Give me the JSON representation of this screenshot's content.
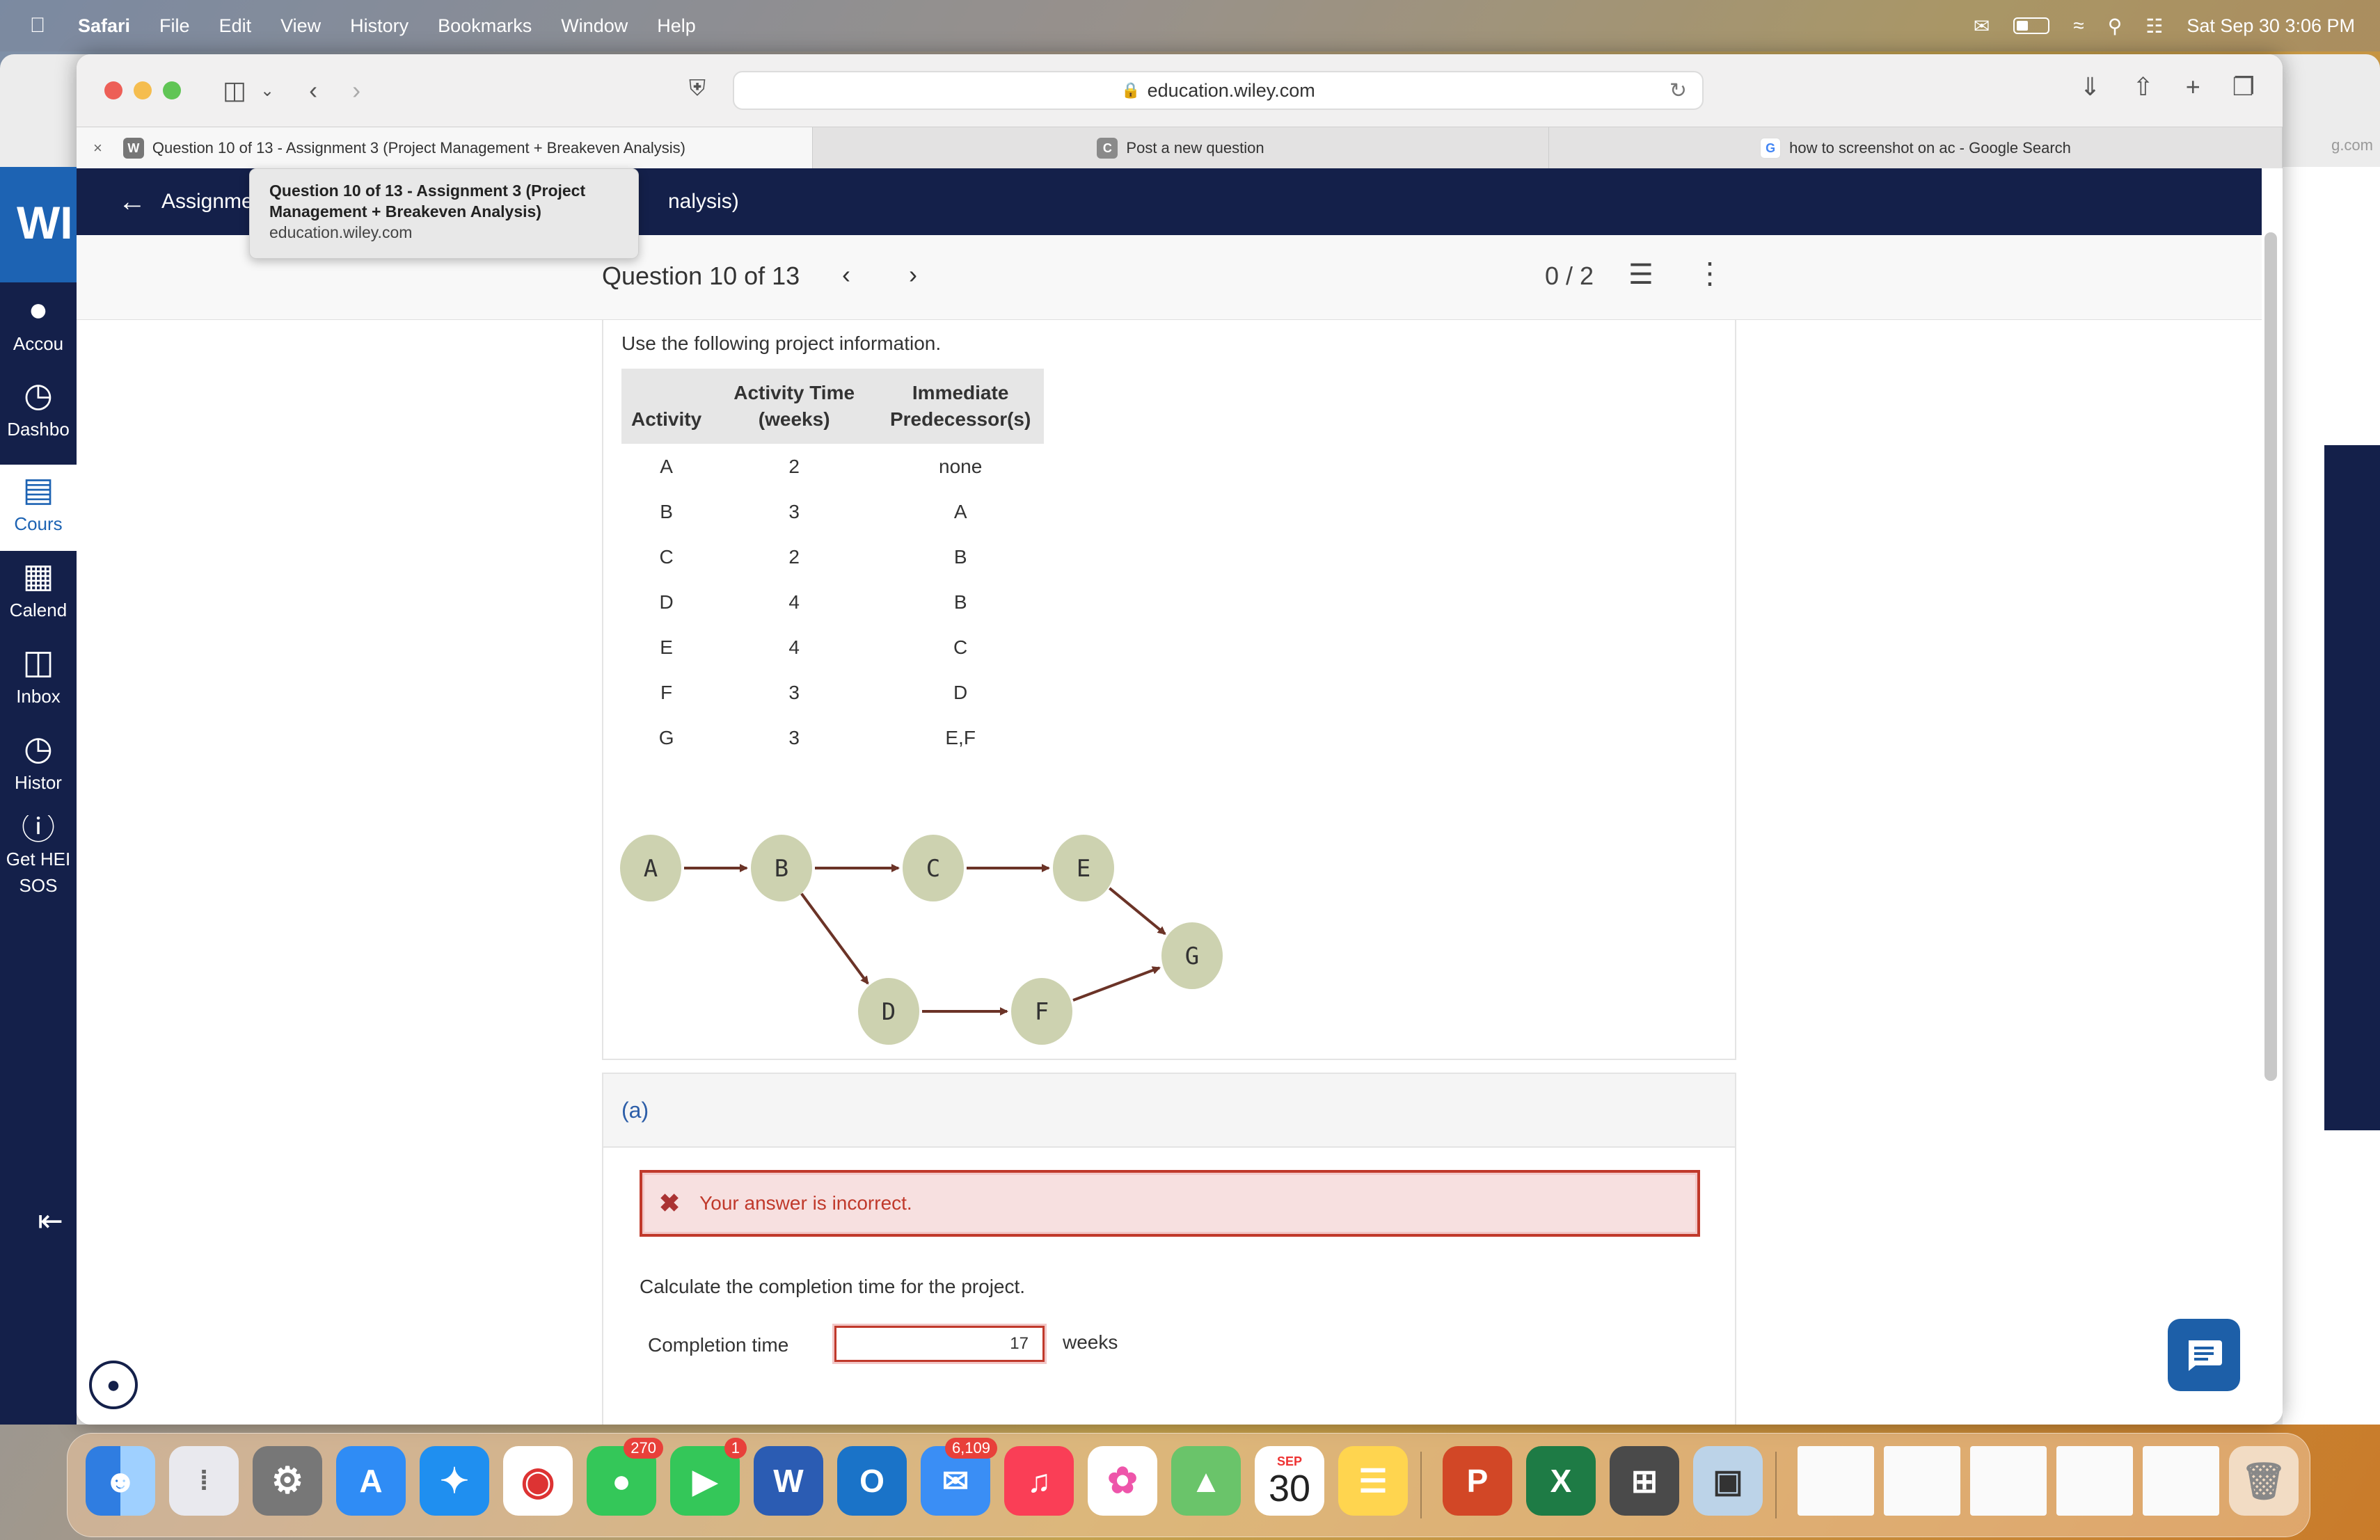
{
  "menubar": {
    "app": "Safari",
    "items": [
      "File",
      "Edit",
      "View",
      "History",
      "Bookmarks",
      "Window",
      "Help"
    ],
    "datetime": "Sat Sep 30  3:06 PM"
  },
  "browser": {
    "address": "education.wiley.com",
    "tabs": [
      {
        "label": "Question 10 of 13 - Assignment 3 (Project Management + Breakeven Analysis)",
        "fav": "W"
      },
      {
        "label": "Post a new question",
        "fav": "C"
      },
      {
        "label": "how to screenshot on ac - Google Search",
        "fav": "G"
      }
    ],
    "bg_url_fragment": "g.com"
  },
  "tooltip": {
    "title": "Question 10 of 13 - Assignment 3 (Project Management + Breakeven Analysis)",
    "url": "education.wiley.com"
  },
  "header": {
    "title_left": "Assignme",
    "title_right": "nalysis)"
  },
  "question_bar": {
    "title": "Question 10 of 13",
    "score": "0 / 2"
  },
  "sidebar": {
    "logo": "WI",
    "items": [
      {
        "label": "Accou",
        "icon": "account-icon"
      },
      {
        "label": "Dashbo",
        "icon": "dashboard-icon"
      },
      {
        "label": "Cours",
        "icon": "courses-icon"
      },
      {
        "label": "Calend",
        "icon": "calendar-icon"
      },
      {
        "label": "Inbox",
        "icon": "inbox-icon"
      },
      {
        "label": "Histor",
        "icon": "history-icon"
      },
      {
        "label": "Get HEI",
        "label2": "SOS",
        "icon": "help-icon"
      }
    ]
  },
  "problem": {
    "intro": "Use the following project information.",
    "table": {
      "headers": [
        "Activity",
        "Activity Time (weeks)",
        "Immediate Predecessor(s)"
      ],
      "header_lines": [
        [
          "Activity"
        ],
        [
          "Activity Time",
          "(weeks)"
        ],
        [
          "Immediate",
          "Predecessor(s)"
        ]
      ],
      "rows": [
        [
          "A",
          "2",
          "none"
        ],
        [
          "B",
          "3",
          "A"
        ],
        [
          "C",
          "2",
          "B"
        ],
        [
          "D",
          "4",
          "B"
        ],
        [
          "E",
          "4",
          "C"
        ],
        [
          "F",
          "3",
          "D"
        ],
        [
          "G",
          "3",
          "E,F"
        ]
      ]
    },
    "network": {
      "nodes": [
        "A",
        "B",
        "C",
        "D",
        "E",
        "F",
        "G"
      ],
      "edges": [
        [
          "A",
          "B"
        ],
        [
          "B",
          "C"
        ],
        [
          "B",
          "D"
        ],
        [
          "C",
          "E"
        ],
        [
          "D",
          "F"
        ],
        [
          "E",
          "G"
        ],
        [
          "F",
          "G"
        ]
      ],
      "node_color": "#cdd2b0",
      "edge_color": "#6b3327"
    }
  },
  "part_a": {
    "label": "(a)",
    "error": "Your answer is incorrect.",
    "prompt": "Calculate the completion time for the project.",
    "field_label": "Completion time",
    "field_value": "17",
    "unit": "weeks"
  },
  "dock": {
    "badges": {
      "messages": "270",
      "facetime": "1",
      "mail": "6,109"
    },
    "calendar": {
      "month": "SEP",
      "day": "30"
    }
  },
  "colors": {
    "navy": "#14204a",
    "wiley_blue": "#1d63b3",
    "error_red": "#c0392b"
  }
}
